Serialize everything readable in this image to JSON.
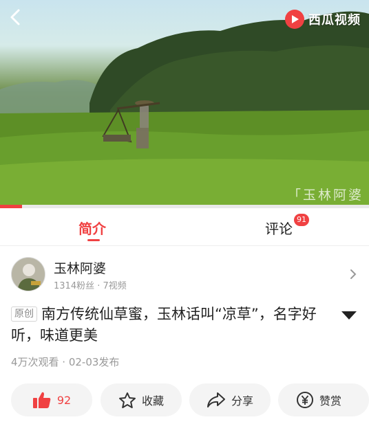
{
  "video": {
    "brand": "西瓜视频",
    "watermark": "「玉林阿婆",
    "progress": 0.06
  },
  "tabs": {
    "intro": "简介",
    "comments": "评论",
    "comments_badge": "91"
  },
  "author": {
    "name": "玉林阿婆",
    "stats": "1314粉丝 · 7视频"
  },
  "video_info": {
    "original_tag": "原创",
    "title": "南方传统仙草蜜，玉林话叫“凉草”，名字好听，味道更美",
    "meta": "4万次观看 · 02-03发布"
  },
  "actions": {
    "like_count": "92",
    "favorite": "收藏",
    "share": "分享",
    "reward": "赞赏"
  },
  "colors": {
    "accent": "#f04142",
    "muted": "#999999",
    "button_bg": "#f4f4f4"
  },
  "icons": [
    "back-arrow-icon",
    "play-logo-icon",
    "thumbs-up-icon",
    "star-icon",
    "share-arrow-icon",
    "yuan-coin-icon",
    "chevron-right-icon",
    "triangle-down-icon"
  ]
}
